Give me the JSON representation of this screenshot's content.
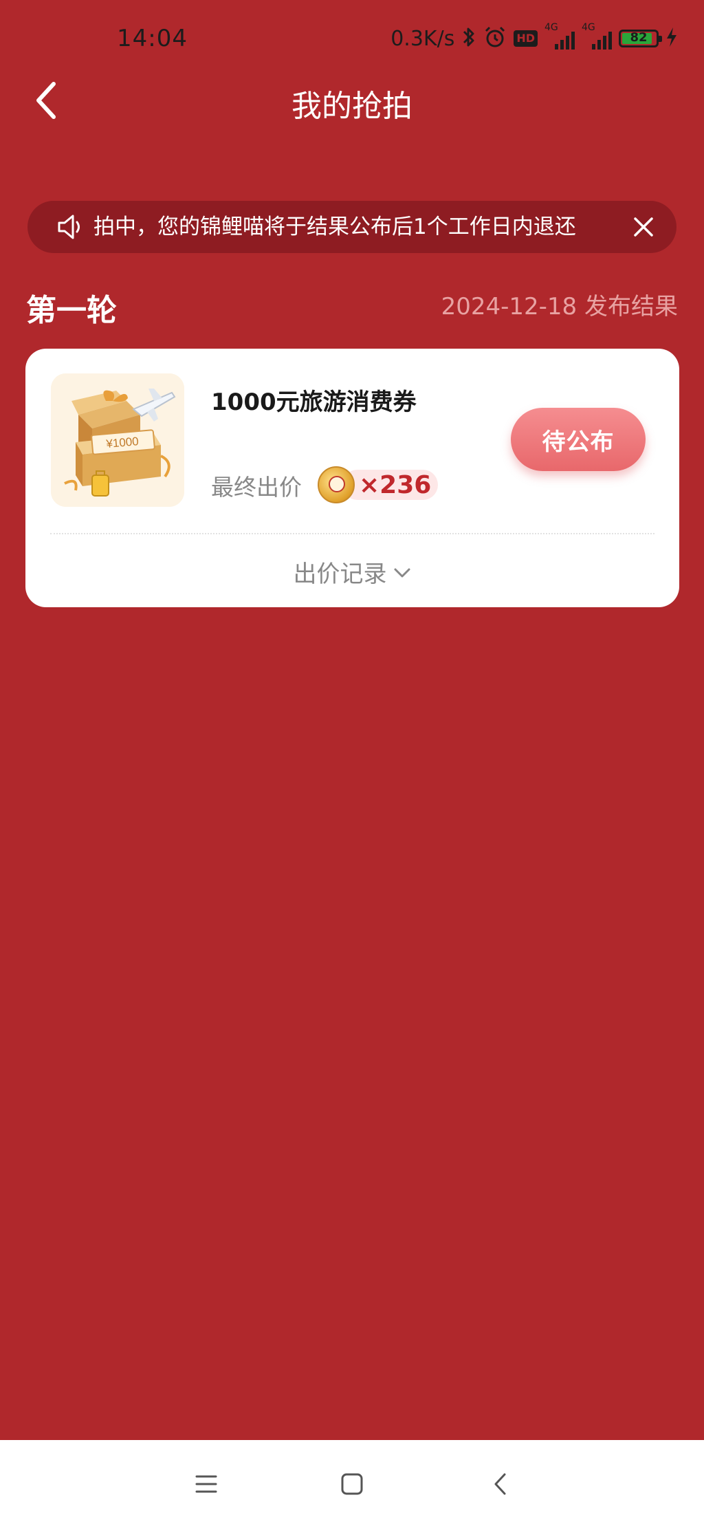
{
  "status_bar": {
    "time": "14:04",
    "net_speed": "0.3K/s",
    "hd": "HD",
    "signal_1_label": "4G",
    "signal_2_label": "4G",
    "battery_level": "82",
    "icons": [
      "bluetooth-icon",
      "alarm-icon",
      "hd-icon",
      "signal-icon",
      "battery-icon",
      "charging-icon"
    ]
  },
  "header": {
    "title": "我的抢拍"
  },
  "notice": {
    "text": "拍中，您的锦鲤喵将于结果公布后1个工作日内退还"
  },
  "round": {
    "title": "第一轮",
    "result_date": "2024-12-18 发布结果"
  },
  "item": {
    "title": "1000元旅游消费券",
    "final_price_label": "最终出价",
    "final_price_value": "×236",
    "status_button": "待公布",
    "thumb_amount": "¥1000",
    "bid_record_label": "出价记录"
  },
  "colors": {
    "page_bg": "#b0282c",
    "notice_bg": "#8e1c22",
    "accent": "#c0282c",
    "button": "#e8686b"
  }
}
